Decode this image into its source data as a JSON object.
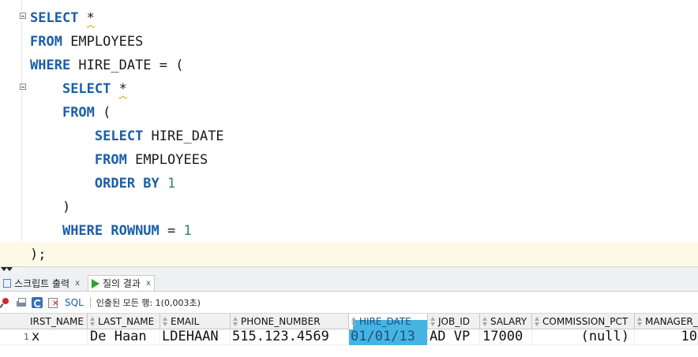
{
  "editor": {
    "lines": [
      [
        {
          "t": "SELECT",
          "c": "kw"
        },
        {
          "t": " "
        },
        {
          "t": "*",
          "c": "star"
        }
      ],
      [
        {
          "t": "FROM",
          "c": "kw"
        },
        {
          "t": " EMPLOYEES"
        }
      ],
      [
        {
          "t": "WHERE",
          "c": "kw"
        },
        {
          "t": " HIRE_DATE = ("
        }
      ],
      [
        {
          "t": "    "
        },
        {
          "t": "SELECT",
          "c": "kw"
        },
        {
          "t": " "
        },
        {
          "t": "*",
          "c": "star"
        }
      ],
      [
        {
          "t": "    "
        },
        {
          "t": "FROM",
          "c": "kw"
        },
        {
          "t": " ("
        }
      ],
      [
        {
          "t": "        "
        },
        {
          "t": "SELECT",
          "c": "kw"
        },
        {
          "t": " HIRE_DATE"
        }
      ],
      [
        {
          "t": "        "
        },
        {
          "t": "FROM",
          "c": "kw"
        },
        {
          "t": " EMPLOYEES"
        }
      ],
      [
        {
          "t": "        "
        },
        {
          "t": "ORDER BY",
          "c": "kw"
        },
        {
          "t": " "
        },
        {
          "t": "1",
          "c": "num"
        }
      ],
      [
        {
          "t": "    )"
        }
      ],
      [
        {
          "t": "    "
        },
        {
          "t": "WHERE ROWNUM",
          "c": "kw"
        },
        {
          "t": " = "
        },
        {
          "t": "1",
          "c": "num"
        }
      ],
      [
        {
          "t": ");"
        }
      ]
    ]
  },
  "tabs": [
    {
      "label": "스크립트 출력",
      "close": "x",
      "icon": "script-icon"
    },
    {
      "label": "질의 결과",
      "close": "x",
      "icon": "play-icon"
    }
  ],
  "toolbar": {
    "sql_label": "SQL",
    "status": "인출된 모든 행: 1(0,003초)"
  },
  "grid": {
    "columns": [
      "IRST_NAME",
      "LAST_NAME",
      "EMAIL",
      "PHONE_NUMBER",
      "HIRE_DATE",
      "JOB_ID",
      "SALARY",
      "COMMISSION_PCT",
      "MANAGER_"
    ],
    "row": {
      "row_number": "1",
      "cells": [
        "x",
        "De Haan",
        "LDEHAAN",
        "515.123.4569",
        "01/01/13",
        "AD VP",
        "17000",
        "(null)",
        "10"
      ]
    },
    "selected_column": "HIRE_DATE"
  },
  "colors": {
    "keyword": "#1a5ea8",
    "number": "#2e8b57",
    "selection": "#46b4e3",
    "current_line": "#fdfae8"
  }
}
